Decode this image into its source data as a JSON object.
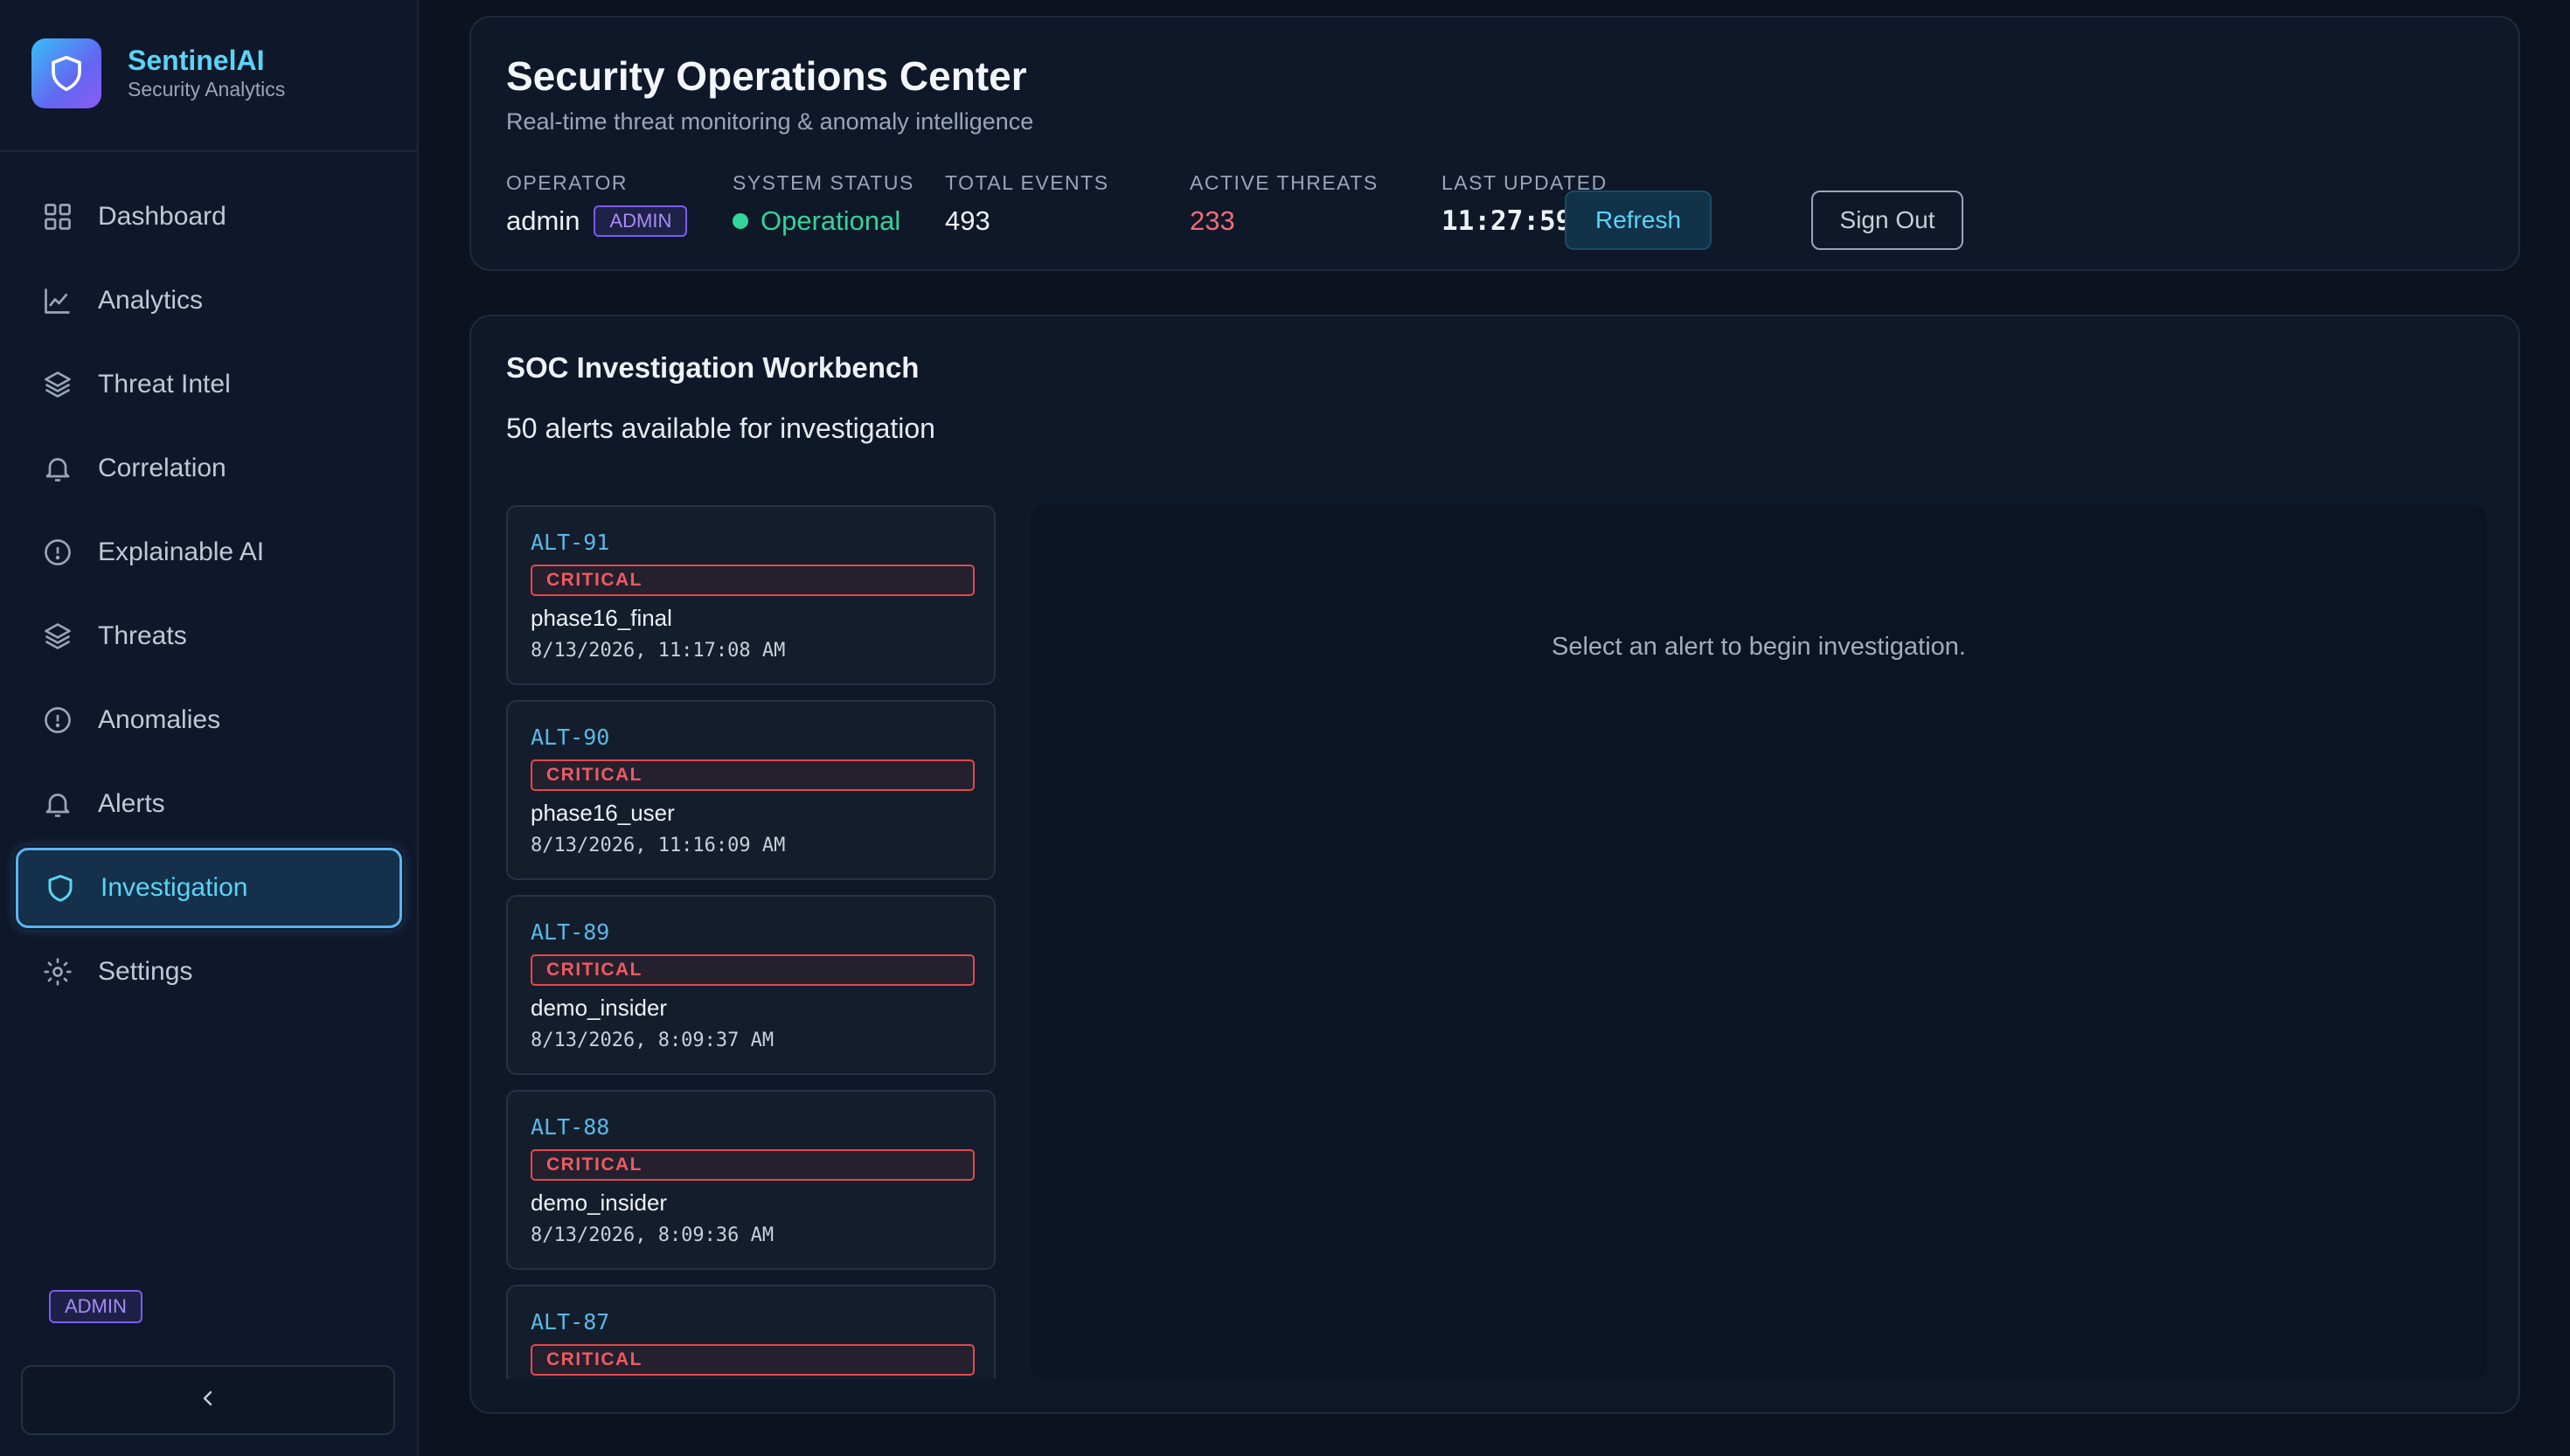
{
  "brand": {
    "name": "SentinelAI",
    "subtitle": "Security Analytics"
  },
  "sidebar": {
    "items": [
      {
        "label": "Dashboard",
        "icon": "grid-icon"
      },
      {
        "label": "Analytics",
        "icon": "line-chart-icon"
      },
      {
        "label": "Threat Intel",
        "icon": "layers-icon"
      },
      {
        "label": "Correlation",
        "icon": "bell-icon"
      },
      {
        "label": "Explainable AI",
        "icon": "info-circle-icon"
      },
      {
        "label": "Threats",
        "icon": "layers-icon"
      },
      {
        "label": "Anomalies",
        "icon": "info-circle-icon"
      },
      {
        "label": "Alerts",
        "icon": "bell-icon"
      },
      {
        "label": "Investigation",
        "icon": "shield-icon",
        "active": true
      },
      {
        "label": "Settings",
        "icon": "gear-icon"
      }
    ],
    "role_badge": "ADMIN"
  },
  "header": {
    "title": "Security Operations Center",
    "subtitle": "Real-time threat monitoring & anomaly intelligence",
    "operator": {
      "label": "OPERATOR",
      "value": "admin",
      "badge": "ADMIN"
    },
    "system_status": {
      "label": "SYSTEM STATUS",
      "value": "Operational"
    },
    "total_events": {
      "label": "TOTAL EVENTS",
      "value": "493"
    },
    "active_threats": {
      "label": "ACTIVE THREATS",
      "value": "233"
    },
    "last_updated": {
      "label": "LAST UPDATED",
      "value": "11:27:59 AM"
    },
    "refresh_label": "Refresh",
    "signout_label": "Sign Out"
  },
  "workbench": {
    "title": "SOC Investigation Workbench",
    "count_text": "50 alerts available for investigation",
    "empty_text": "Select an alert to begin investigation.",
    "alerts": [
      {
        "id": "ALT-91",
        "severity": "CRITICAL",
        "user": "phase16_final",
        "time": "8/13/2026, 11:17:08 AM"
      },
      {
        "id": "ALT-90",
        "severity": "CRITICAL",
        "user": "phase16_user",
        "time": "8/13/2026, 11:16:09 AM"
      },
      {
        "id": "ALT-89",
        "severity": "CRITICAL",
        "user": "demo_insider",
        "time": "8/13/2026, 8:09:37 AM"
      },
      {
        "id": "ALT-88",
        "severity": "CRITICAL",
        "user": "demo_insider",
        "time": "8/13/2026, 8:09:36 AM"
      },
      {
        "id": "ALT-87",
        "severity": "CRITICAL",
        "user": "",
        "time": ""
      }
    ]
  },
  "colors": {
    "accent": "#5ad4f5",
    "critical": "#e5484d",
    "operational": "#34d399",
    "threats": "#f26b78",
    "admin": "#7c5cf0"
  }
}
